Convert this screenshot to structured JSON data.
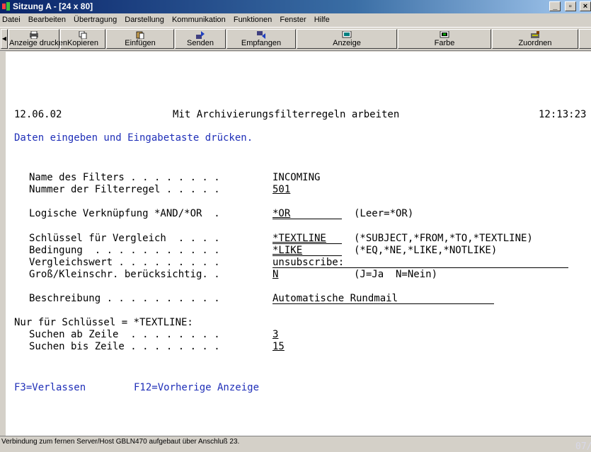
{
  "window": {
    "title": "Sitzung A - [24 x 80]",
    "controls": {
      "minimize": "_",
      "maximize": "▫",
      "close": "×"
    }
  },
  "menubar": {
    "items": [
      "Datei",
      "Bearbeiten",
      "Übertragung",
      "Darstellung",
      "Kommunikation",
      "Funktionen",
      "Fenster",
      "Hilfe"
    ]
  },
  "toolbar": {
    "buttons": [
      {
        "label": "Anzeige drucken",
        "icon": "printer-icon"
      },
      {
        "label": "Kopieren",
        "icon": "copy-icon"
      },
      {
        "label": "Einfügen",
        "icon": "paste-icon"
      },
      {
        "label": "Senden",
        "icon": "send-icon"
      },
      {
        "label": "Empfangen",
        "icon": "receive-icon"
      },
      {
        "label": "Anzeige",
        "icon": "display-icon"
      },
      {
        "label": "Farbe",
        "icon": "color-icon"
      },
      {
        "label": "Zuordnen",
        "icon": "map-icon"
      }
    ]
  },
  "terminal": {
    "date": "12.06.02",
    "title": "Mit Archivierungsfilterregeln arbeiten",
    "time": "12:13:23",
    "instruction": "Daten eingeben und Eingabetaste drücken.",
    "fields": {
      "filter_name": {
        "label": "Name des Filters . . . . . . . .",
        "value": "INCOMING"
      },
      "rule_number": {
        "label": "Nummer der Filterregel . . . . .",
        "value": "501"
      },
      "logic": {
        "label": "Logische Verknüpfung *AND/*OR  .",
        "value": "*OR",
        "hint": "(Leer=*OR)"
      },
      "key": {
        "label": "Schlüssel für Vergleich  . . . .",
        "value": "*TEXTLINE",
        "hint": "(*SUBJECT,*FROM,*TO,*TEXTLINE)"
      },
      "condition": {
        "label": "Bedingung  . . . . . . . . . . .",
        "value": "*LIKE",
        "hint": "(*EQ,*NE,*LIKE,*NOTLIKE)"
      },
      "compare_value": {
        "label": "Vergleichswert . . . . . . . . .",
        "value": "unsubscribe:"
      },
      "case": {
        "label": "Groß/Kleinschr. berücksichtig. .",
        "value": "N",
        "hint": "(J=Ja  N=Nein)"
      },
      "description": {
        "label": "Beschreibung . . . . . . . . . .",
        "value": "Automatische Rundmail"
      }
    },
    "textline_section": {
      "heading": "Nur für Schlüssel = *TEXTLINE:",
      "from_line": {
        "label": "Suchen ab Zeile  . . . . . . . .",
        "value": "3"
      },
      "to_line": {
        "label": "Suchen bis Zeile . . . . . . . .",
        "value": "15"
      }
    },
    "function_keys": {
      "f3": "F3=Verlassen",
      "f12": "F12=Vorherige Anzeige"
    },
    "cursor_position": "07/03"
  },
  "statusbar": {
    "text": "Verbindung zum fernen Server/Host GBLN470 aufgebaut über Anschluß 23."
  },
  "colors": {
    "title_bar": "#0a246a",
    "terminal_bg": "#ffffff",
    "terminal_text": "#000000",
    "terminal_blue": "#1f2fb8",
    "chrome": "#d4d0c8"
  }
}
